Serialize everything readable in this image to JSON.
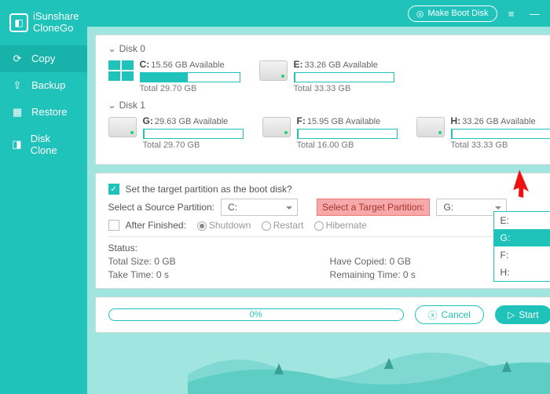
{
  "app": {
    "name1": "iSunshare",
    "name2": "CloneGo"
  },
  "titlebar": {
    "makeBoot": "Make Boot Disk"
  },
  "nav": [
    {
      "label": "Copy",
      "icon": "copy-icon",
      "active": true
    },
    {
      "label": "Backup",
      "icon": "backup-icon",
      "active": false
    },
    {
      "label": "Restore",
      "icon": "restore-icon",
      "active": false
    },
    {
      "label": "Disk Clone",
      "icon": "diskclone-icon",
      "active": false
    }
  ],
  "disks": [
    {
      "name": "Disk 0",
      "parts": [
        {
          "letter": "C:",
          "avail": "15.56 GB Available",
          "total": "Total 29.70 GB",
          "fillPct": 48,
          "isWin": true
        },
        {
          "letter": "E:",
          "avail": "33.26 GB Available",
          "total": "Total 33.33 GB",
          "fillPct": 1,
          "isWin": false
        }
      ]
    },
    {
      "name": "Disk 1",
      "parts": [
        {
          "letter": "G:",
          "avail": "29.63 GB Available",
          "total": "Total 29.70 GB",
          "fillPct": 1,
          "isWin": false
        },
        {
          "letter": "F:",
          "avail": "15.95 GB Available",
          "total": "Total 16.00 GB",
          "fillPct": 1,
          "isWin": false
        },
        {
          "letter": "H:",
          "avail": "33.26 GB Available",
          "total": "Total 33.33 GB",
          "fillPct": 1,
          "isWin": false
        }
      ]
    }
  ],
  "options": {
    "bootCheckLabel": "Set the target partition as the boot disk?",
    "bootChecked": true,
    "sourceLabel": "Select a Source Partition:",
    "sourceValue": "C:",
    "targetLabel": "Select a Target Partition:",
    "targetValue": "G:",
    "afterLabel": "After Finished:",
    "afterChecked": false,
    "radios": [
      "Shutdown",
      "Restart",
      "Hibernate"
    ],
    "radioSelected": 0
  },
  "dropdown": {
    "items": [
      "E:",
      "G:",
      "F:",
      "H:"
    ],
    "selected": 1
  },
  "status": {
    "heading": "Status:",
    "totalSize": "Total Size: 0 GB",
    "haveCopied": "Have Copied: 0 GB",
    "takeTime": "Take Time: 0 s",
    "remaining": "Remaining Time: 0 s"
  },
  "footer": {
    "progress": "0%",
    "cancel": "Cancel",
    "start": "Start"
  }
}
